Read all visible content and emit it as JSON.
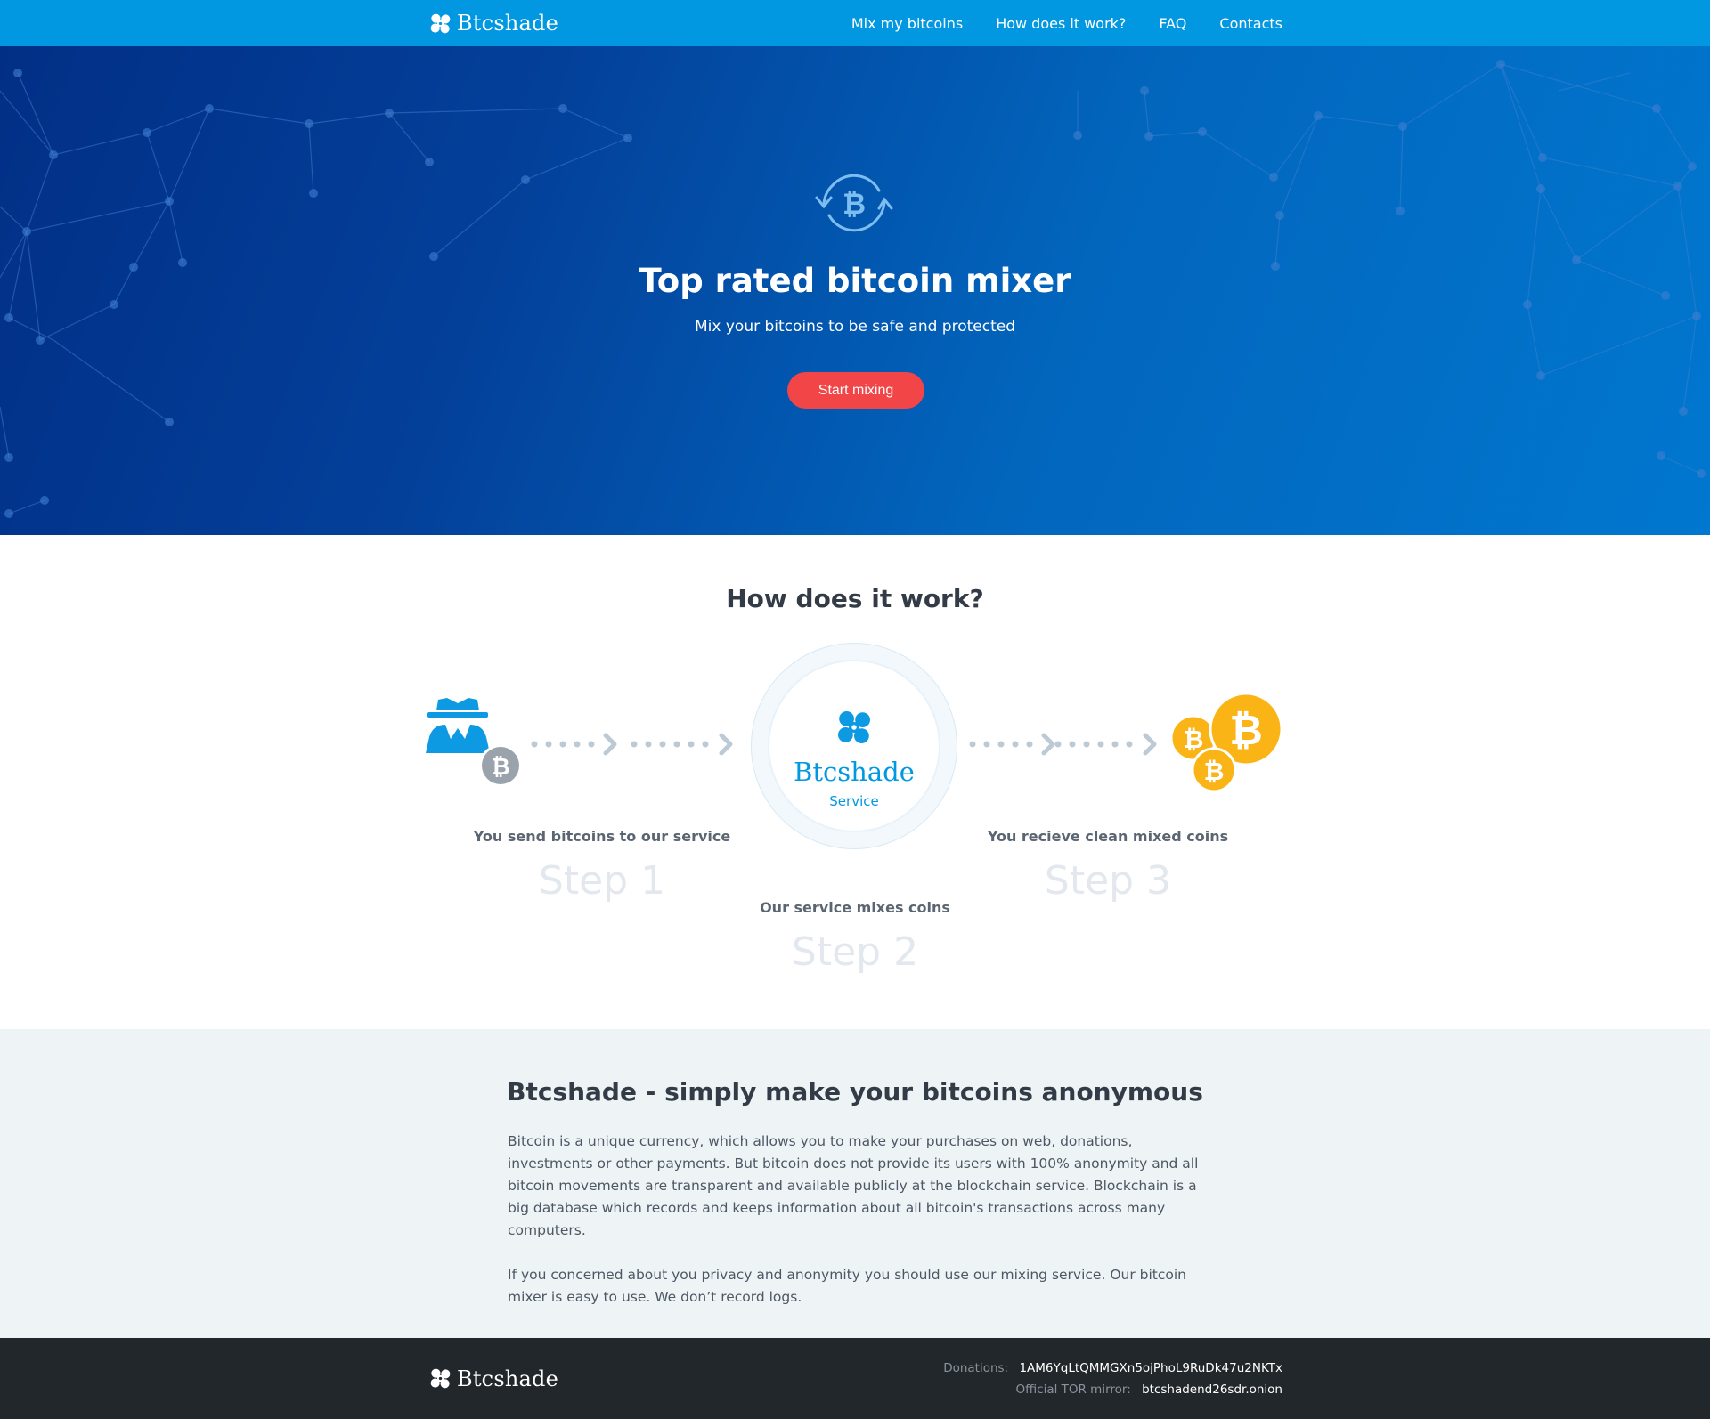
{
  "brand": {
    "name": "Btcshade"
  },
  "nav": {
    "items": [
      {
        "label": "Mix my bitcoins"
      },
      {
        "label": "How does it work?"
      },
      {
        "label": "FAQ"
      },
      {
        "label": "Contacts"
      }
    ]
  },
  "hero": {
    "icon": "bitcoin-exchange-icon",
    "title": "Top rated bitcoin mixer",
    "subtitle": "Mix your bitcoins to be safe and protected",
    "cta_label": "Start mixing"
  },
  "how": {
    "title": "How does it work?",
    "service_brand": "Btcshade",
    "service_label": "Service",
    "steps": [
      {
        "caption": "You send bitcoins to our service",
        "number": "Step 1",
        "icon": "anonymous-user-bitcoin-icon"
      },
      {
        "caption": "Our service mixes coins",
        "number": "Step 2",
        "icon": "mixer-fan-icon"
      },
      {
        "caption": "You recieve clean mixed coins",
        "number": "Step 3",
        "icon": "bitcoin-coins-icon"
      }
    ]
  },
  "about": {
    "title": "Btcshade - simply make your bitcoins anonymous",
    "paragraphs": [
      "Bitcoin is a unique currency, which allows you to make your purchases on web, donations, investments or other payments. But bitcoin does not provide its users with 100% anonymity and all bitcoin movements are transparent and available publicly at the blockchain service. Blockchain is a big database which records and keeps information about all bitcoin's transactions across many computers.",
      "If you concerned about you privacy and anonymity you should use our mixing service. Our bitcoin mixer is easy to use. We don’t record logs."
    ]
  },
  "footer": {
    "donations_label": "Donations:",
    "donations_address": "1AM6YqLtQMMGXn5ojPhoL9RuDk47u2NKTx",
    "mirror_label": "Official TOR mirror:",
    "mirror_address": "btcshadend26sdr.onion"
  },
  "colors": {
    "accent": "#0198e1",
    "cta": "#f24547",
    "coin": "#fbb416",
    "footer_bg": "#22272b",
    "about_bg": "#eef3f6"
  }
}
